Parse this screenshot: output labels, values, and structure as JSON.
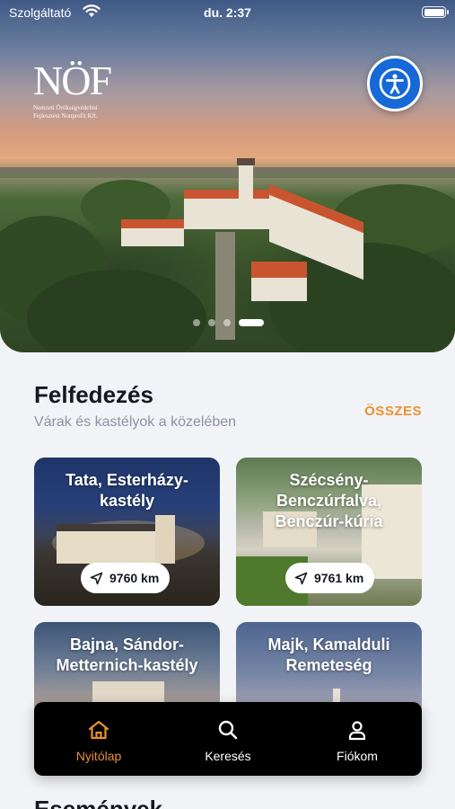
{
  "status_bar": {
    "carrier": "Szolgáltató",
    "time": "du. 2:37"
  },
  "logo": {
    "mark": "NÖF",
    "subtitle_line1": "Nemzeti Örökségvédelmi",
    "subtitle_line2": "Fejlesztési Nonprofit Kft."
  },
  "hero": {
    "slides_total": 4,
    "active_slide": 4
  },
  "discover": {
    "title": "Felfedezés",
    "subtitle": "Várak és kastélyok a közelében",
    "all_label": "ÖSSZES",
    "cards": [
      {
        "title": "Tata, Esterházy-kastély",
        "distance": "9760 km"
      },
      {
        "title": "Szécsény-Benczúrfalva, Benczúr-kúria",
        "distance": "9761 km"
      },
      {
        "title": "Bajna, Sándor-Metternich-kastély"
      },
      {
        "title": "Majk, Kamalduli Remeteség"
      }
    ]
  },
  "tabbar": {
    "items": [
      {
        "label": "Nyitólap",
        "icon": "home-icon",
        "active": true
      },
      {
        "label": "Keresés",
        "icon": "search-icon",
        "active": false
      },
      {
        "label": "Fiókom",
        "icon": "account-icon",
        "active": false
      }
    ]
  },
  "next_section": {
    "title": "Események"
  },
  "colors": {
    "accent": "#e8922f",
    "a11y_blue": "#1669d6",
    "tabbar_bg": "#000000"
  }
}
